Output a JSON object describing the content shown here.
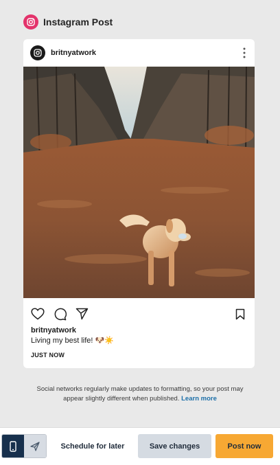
{
  "header": {
    "title": "Instagram Post",
    "icon": "instagram-icon"
  },
  "post": {
    "username": "britnyatwork",
    "caption_user": "britnyatwork",
    "caption_text": "Living my best life! 🐶☀️",
    "timestamp": "JUST NOW",
    "photo": "golden-retriever-in-autumn-field"
  },
  "disclaimer": {
    "text": "Social networks regularly make updates to formatting, so your post may appear slightly different when published.",
    "link": "Learn more"
  },
  "footer": {
    "preview_mode_active": "mobile",
    "schedule_label": "Schedule for later",
    "save_label": "Save changes",
    "post_label": "Post now"
  },
  "colors": {
    "brand_instagram": "#e3336b",
    "post_button": "#f7a833",
    "save_button": "#d5dbe2",
    "active_toggle": "#17304d",
    "link": "#1c6fa8"
  }
}
